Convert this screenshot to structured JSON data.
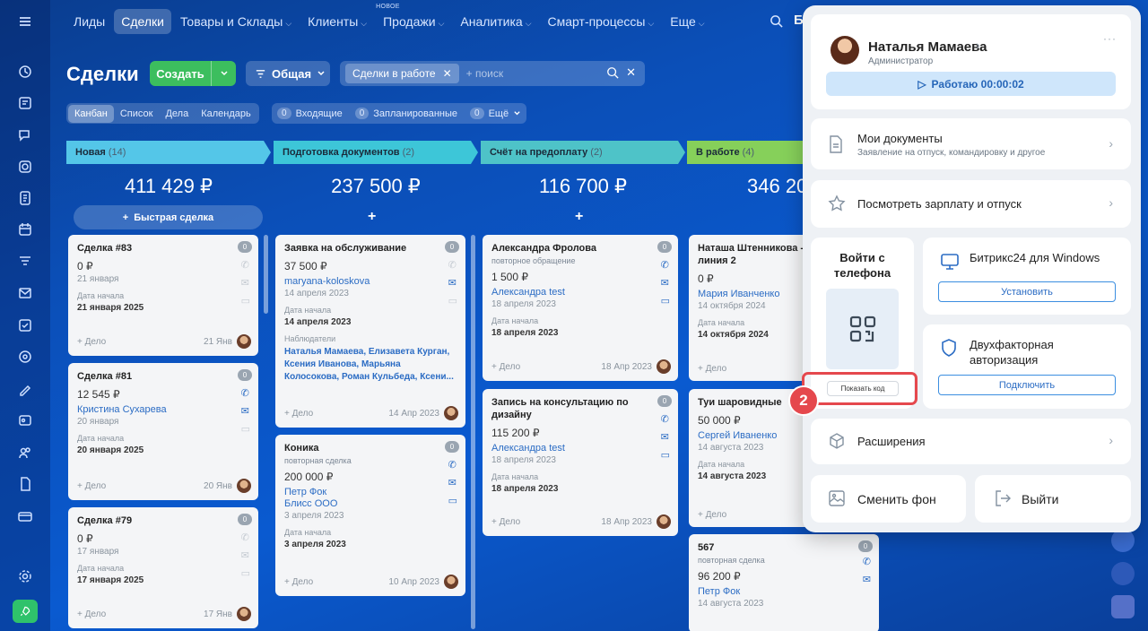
{
  "nav": {
    "items": [
      "Лиды",
      "Сделки",
      "Товары и Склады",
      "Клиенты",
      "Продажи",
      "Аналитика",
      "Смарт-процессы",
      "Еще"
    ],
    "new_badge": "НОВОЕ",
    "cut_letter": "Б"
  },
  "page": {
    "title": "Сделки",
    "create_label": "Создать",
    "general_label": "Общая",
    "filter_chip": "Сделки в работе",
    "search_placeholder": "+ поиск"
  },
  "view_tabs": [
    "Канбан",
    "Список",
    "Дела",
    "Календарь"
  ],
  "counters": [
    {
      "n": "0",
      "label": "Входящие"
    },
    {
      "n": "0",
      "label": "Запланированные"
    },
    {
      "n": "0",
      "label": "Ещё"
    }
  ],
  "stages": [
    {
      "name": "Новая",
      "count": "(14)",
      "sum": "411 429 ₽",
      "color": "#54c6e8"
    },
    {
      "name": "Подготовка документов",
      "count": "(2)",
      "sum": "237 500 ₽",
      "color": "#3dc6d8"
    },
    {
      "name": "Счёт на предоплату",
      "count": "(2)",
      "sum": "116 700 ₽",
      "color": "#4ec3c8"
    },
    {
      "name": "В работе",
      "count": "(4)",
      "sum": "346 20",
      "color": "#86d05a"
    }
  ],
  "quick_deal": "Быстрая сделка",
  "plus": "+",
  "deal_action": "+ Дело",
  "cards": {
    "c1": [
      {
        "title": "Сделка #83",
        "price": "0 ₽",
        "date": "21 января",
        "start_label": "Дата начала",
        "start": "21 января 2025",
        "foot_date": "21 Янв",
        "badge": "0"
      },
      {
        "title": "Сделка #81",
        "price": "12 545 ₽",
        "client": "Кристина Сухарева",
        "date": "20 января",
        "start_label": "Дата начала",
        "start": "20 января 2025",
        "foot_date": "20 Янв",
        "badge": "0"
      },
      {
        "title": "Сделка #79",
        "price": "0 ₽",
        "date": "17 января",
        "start_label": "Дата начала",
        "start": "17 января 2025",
        "foot_date": "17 Янв",
        "badge": "0"
      }
    ],
    "c2": [
      {
        "title": "Заявка на обслуживание",
        "price": "37 500 ₽",
        "client": "maryana-koloskova",
        "date": "14 апреля 2023",
        "start_label": "Дата начала",
        "start": "14 апреля 2023",
        "observers_label": "Наблюдатели",
        "observers": "Наталья Мамаева, Елизавета Курган, Ксения Иванова, Марьяна Колосокова, Роман Кульбеда, Ксени...",
        "foot_date": "14 Апр 2023",
        "badge": "0"
      },
      {
        "title": "Коника",
        "sub": "повторная сделка",
        "price": "200 000 ₽",
        "client": "Петр Фок",
        "client2": "Блисс ООО",
        "date": "3 апреля 2023",
        "start_label": "Дата начала",
        "start": "3 апреля 2023",
        "foot_date": "10 Апр 2023",
        "badge": "0"
      }
    ],
    "c3": [
      {
        "title": "Александра Фролова",
        "sub": "повторное обращение",
        "price": "1 500 ₽",
        "client": "Александра test",
        "date": "18 апреля 2023",
        "start_label": "Дата начала",
        "start": "18 апреля 2023",
        "foot_date": "18 Апр 2023",
        "badge": "0"
      },
      {
        "title": "Запись на консультацию по дизайну",
        "price": "115 200 ₽",
        "client": "Александра test",
        "date": "18 апреля 2023",
        "start_label": "Дата начала",
        "start": "18 апреля 2023",
        "foot_date": "18 Апр 2023",
        "badge": "0"
      }
    ],
    "c4": [
      {
        "title": "Наташа Штенникова - линия 2",
        "price": "0 ₽",
        "client": "Мария Иванченко",
        "date": "14 октября 2024",
        "start_label": "Дата начала",
        "start": "14 октября 2024"
      },
      {
        "title": "Туи шаровидные",
        "price": "50 000 ₽",
        "client": "Сергей Иваненко",
        "date": "14 августа 2023",
        "start_label": "Дата начала",
        "start": "14 августа 2023"
      },
      {
        "title": "567",
        "sub": "повторная сделка",
        "price": "96 200 ₽",
        "client": "Петр Фок",
        "date": "14 августа 2023",
        "badge": "0"
      }
    ]
  },
  "panel": {
    "name": "Наталья Мамаева",
    "role": "Администратор",
    "work_btn": "Работаю 00:00:02",
    "docs_title": "Мои документы",
    "docs_sub": "Заявление на отпуск, командировку и другое",
    "salary": "Посмотреть зарплату и отпуск",
    "phone_login": "Войти с телефона",
    "show_code": "Показать код",
    "windows_title": "Битрикс24 для Windows",
    "install": "Установить",
    "twofa_title": "Двухфакторная авторизация",
    "connect": "Подключить",
    "extensions": "Расширения",
    "change_bg": "Сменить фон",
    "logout": "Выйти"
  },
  "step_number": "2"
}
